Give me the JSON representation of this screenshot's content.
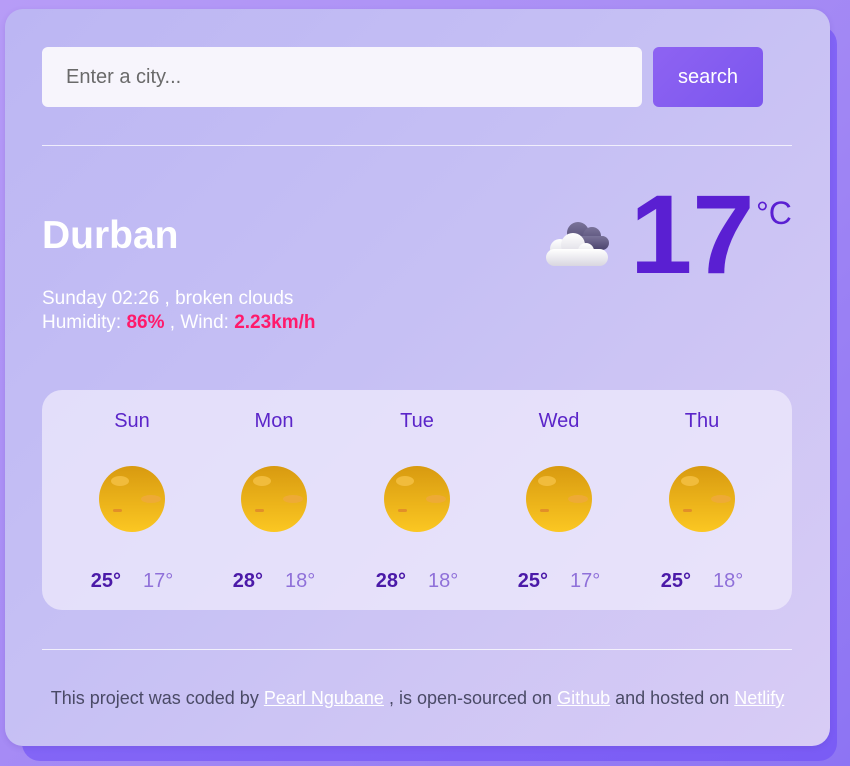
{
  "search": {
    "placeholder": "Enter a city...",
    "value": "",
    "button_label": "search"
  },
  "current": {
    "city": "Durban",
    "day_time": "Sunday 02:26",
    "description": "broken clouds",
    "humidity_label": "Humidity:",
    "humidity_value": "86%",
    "wind_label": "Wind:",
    "wind_value": "2.23km/h",
    "icon": "broken-clouds-icon",
    "temperature": "17",
    "unit": "°C"
  },
  "forecast": [
    {
      "day": "Sun",
      "max": "25°",
      "min": "17°",
      "icon": "sun-icon"
    },
    {
      "day": "Mon",
      "max": "28°",
      "min": "18°",
      "icon": "sun-icon"
    },
    {
      "day": "Tue",
      "max": "28°",
      "min": "18°",
      "icon": "sun-icon"
    },
    {
      "day": "Wed",
      "max": "25°",
      "min": "17°",
      "icon": "sun-icon"
    },
    {
      "day": "Thu",
      "max": "25°",
      "min": "18°",
      "icon": "sun-icon"
    }
  ],
  "footer": {
    "text_1": "This project was coded by",
    "author_link": "Pearl Ngubane",
    "text_2": ", is open-sourced on",
    "github_link": "Github",
    "text_3": "and hosted on",
    "netlify_link": "Netlify"
  },
  "colors": {
    "accent": "#5a1fd2",
    "highlight": "#ff1a6b",
    "button": "#8e63f2"
  }
}
